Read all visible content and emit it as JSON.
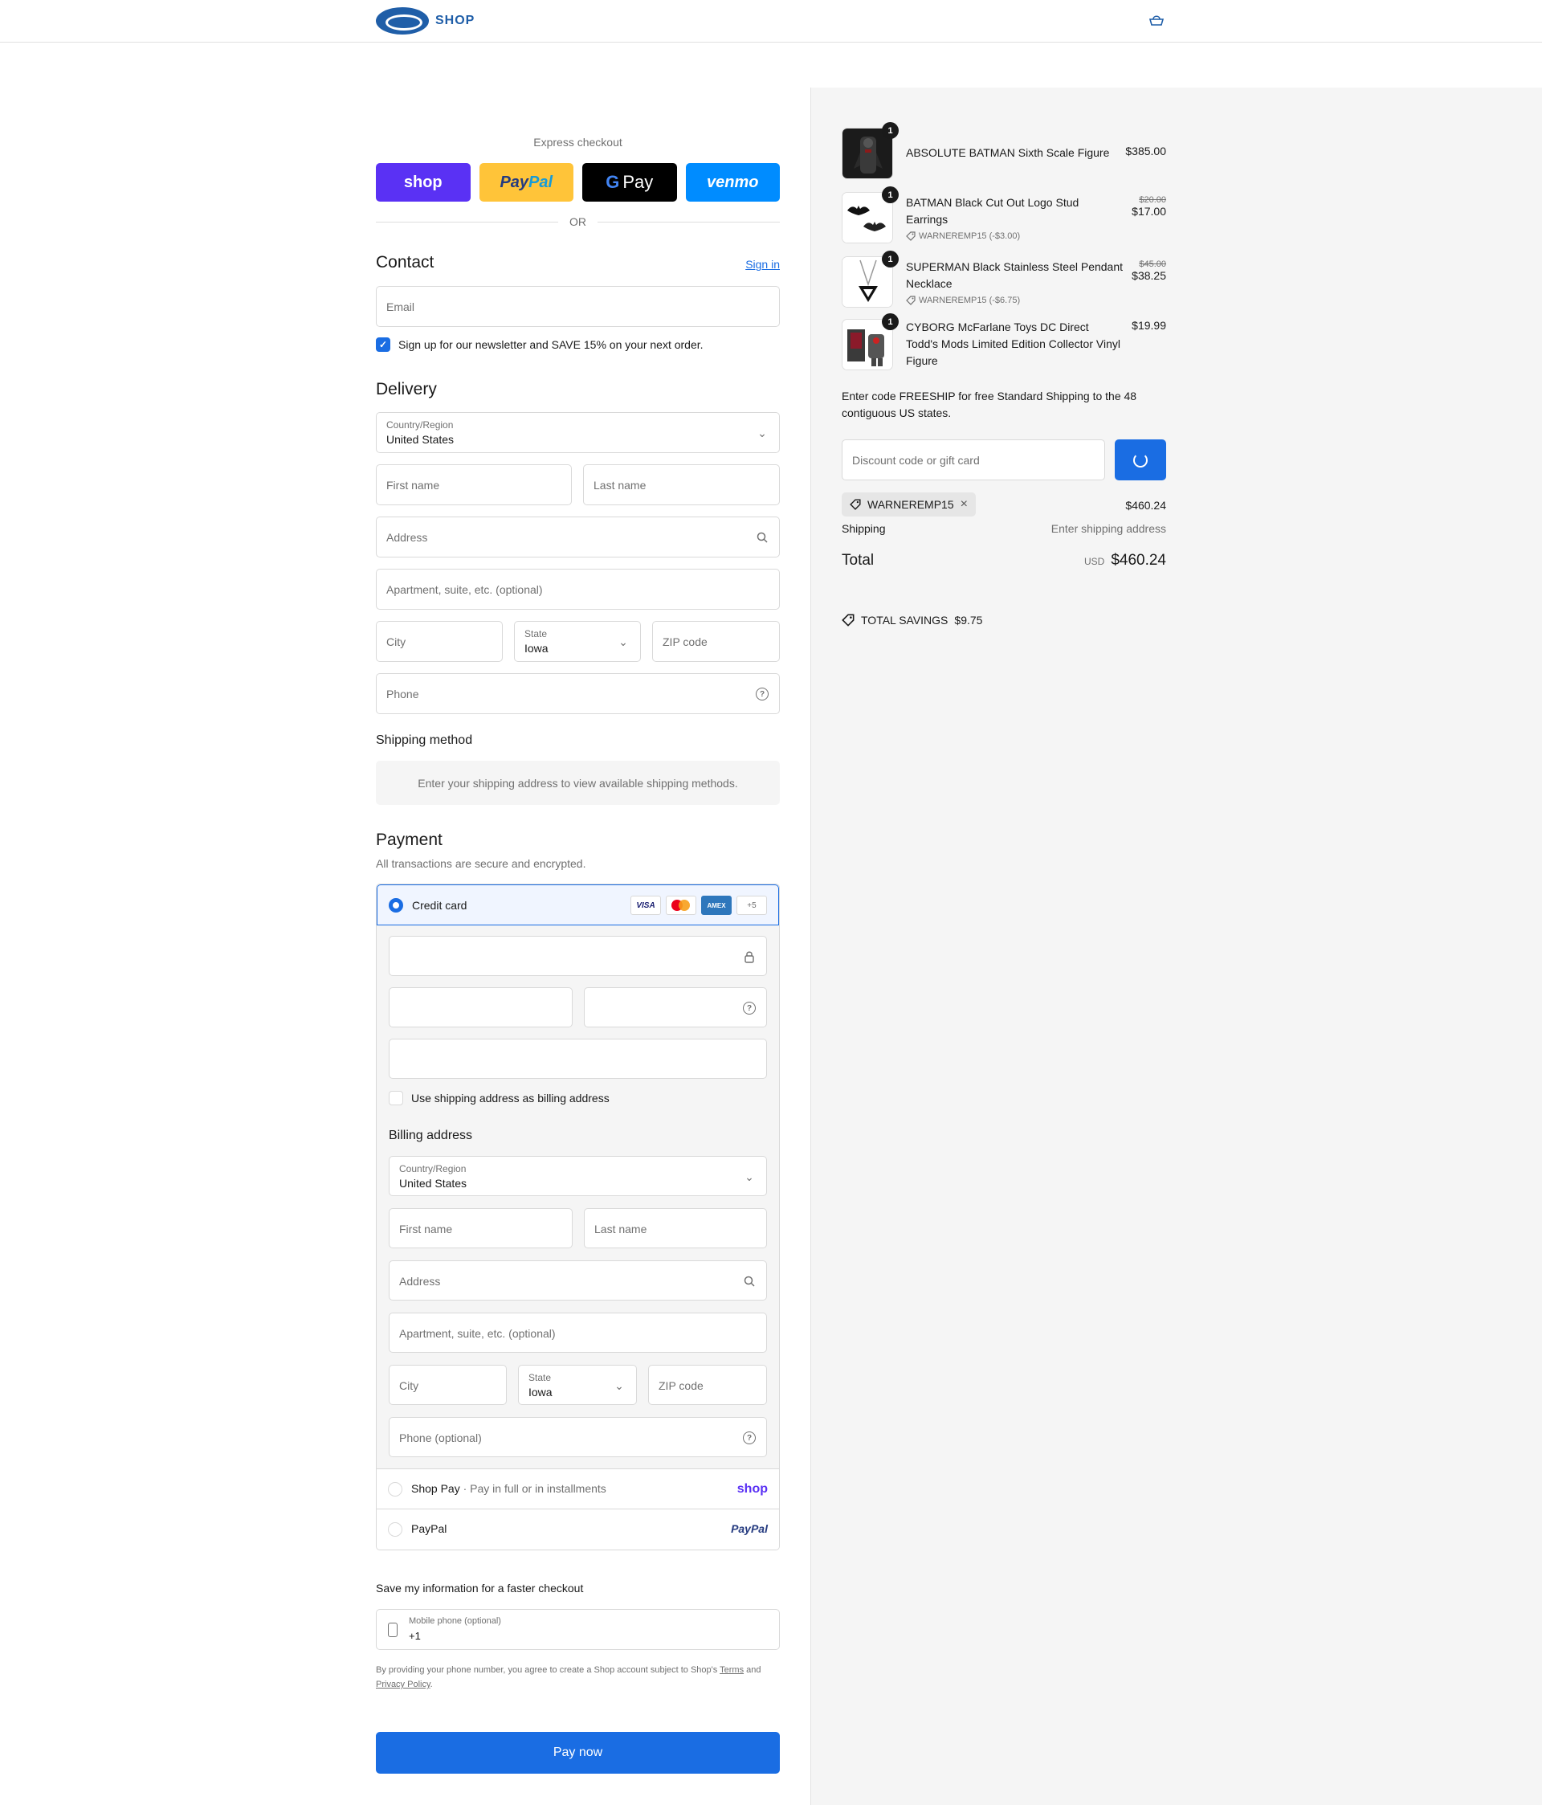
{
  "header": {
    "logo_text": "SHOP",
    "cart_icon": "bag-icon"
  },
  "express": {
    "title": "Express checkout",
    "shop_label": "shop",
    "paypal_label_a": "Pay",
    "paypal_label_b": "Pal",
    "gpay_g": "G",
    "gpay_label": "Pay",
    "venmo_label": "venmo",
    "or_label": "OR"
  },
  "contact": {
    "heading": "Contact",
    "sign_in": "Sign in",
    "email_placeholder": "Email",
    "newsletter_label": "Sign up for our newsletter and SAVE 15% on your next order.",
    "newsletter_checked": true
  },
  "delivery": {
    "heading": "Delivery",
    "country_label": "Country/Region",
    "country_value": "United States",
    "first_name": "First name",
    "last_name": "Last name",
    "address": "Address",
    "apartment": "Apartment, suite, etc. (optional)",
    "city": "City",
    "state_label": "State",
    "state_value": "Iowa",
    "zip": "ZIP code",
    "phone": "Phone"
  },
  "shipping_method": {
    "heading": "Shipping method",
    "note": "Enter your shipping address to view available shipping methods."
  },
  "payment": {
    "heading": "Payment",
    "subheading": "All transactions are secure and encrypted.",
    "credit_card_label": "Credit card",
    "card_brands": [
      "VISA",
      "mastercard",
      "AMEX",
      "+5"
    ],
    "use_shipping_label": "Use shipping address as billing address",
    "billing_heading": "Billing address",
    "billing": {
      "country_label": "Country/Region",
      "country_value": "United States",
      "first_name": "First name",
      "last_name": "Last name",
      "address": "Address",
      "apartment": "Apartment, suite, etc. (optional)",
      "city": "City",
      "state_label": "State",
      "state_value": "Iowa",
      "zip": "ZIP code",
      "phone": "Phone (optional)"
    },
    "shop_pay_label": "Shop Pay",
    "shop_pay_sep": "·",
    "shop_pay_desc": "Pay in full or in installments",
    "shop_pay_brand": "shop",
    "paypal_label": "PayPal",
    "paypal_brand": "PayPal"
  },
  "save_info": {
    "heading": "Save my information for a faster checkout",
    "mobile_label": "Mobile phone (optional)",
    "mobile_value": "+1",
    "terms_prefix": "By providing your phone number, you agree to create a Shop account subject to Shop's",
    "terms_link": "Terms",
    "terms_and": "and",
    "privacy_link": "Privacy Policy",
    "terms_suffix": "."
  },
  "pay_now": "Pay now",
  "summary": {
    "items": [
      {
        "qty": "1",
        "name": "ABSOLUTE BATMAN Sixth Scale Figure",
        "price": "$385.00",
        "old_price": "",
        "discount": ""
      },
      {
        "qty": "1",
        "name": "BATMAN Black Cut Out Logo Stud Earrings",
        "price": "$17.00",
        "old_price": "$20.00",
        "discount": "WARNEREMP15 (-$3.00)"
      },
      {
        "qty": "1",
        "name": "SUPERMAN Black Stainless Steel Pendant Necklace",
        "price": "$38.25",
        "old_price": "$45.00",
        "discount": "WARNEREMP15 (-$6.75)"
      },
      {
        "qty": "1",
        "name": "CYBORG McFarlane Toys DC Direct Todd's Mods Limited Edition Collector Vinyl Figure",
        "price": "$19.99",
        "old_price": "",
        "discount": ""
      }
    ],
    "promo_note": "Enter code FREESHIP for free Standard Shipping to the 48 contiguous US states.",
    "discount_placeholder": "Discount code or gift card",
    "applied_code": "WARNEREMP15",
    "subtotal": "$460.24",
    "shipping_label": "Shipping",
    "shipping_value": "Enter shipping address",
    "total_label": "Total",
    "currency": "USD",
    "total_value": "$460.24",
    "savings_label": "TOTAL SAVINGS",
    "savings_value": "$9.75"
  },
  "colors": {
    "accent": "#1a6de3",
    "shop_purple": "#5a31f4",
    "paypal_yellow": "#ffc439",
    "venmo_blue": "#008cff"
  }
}
